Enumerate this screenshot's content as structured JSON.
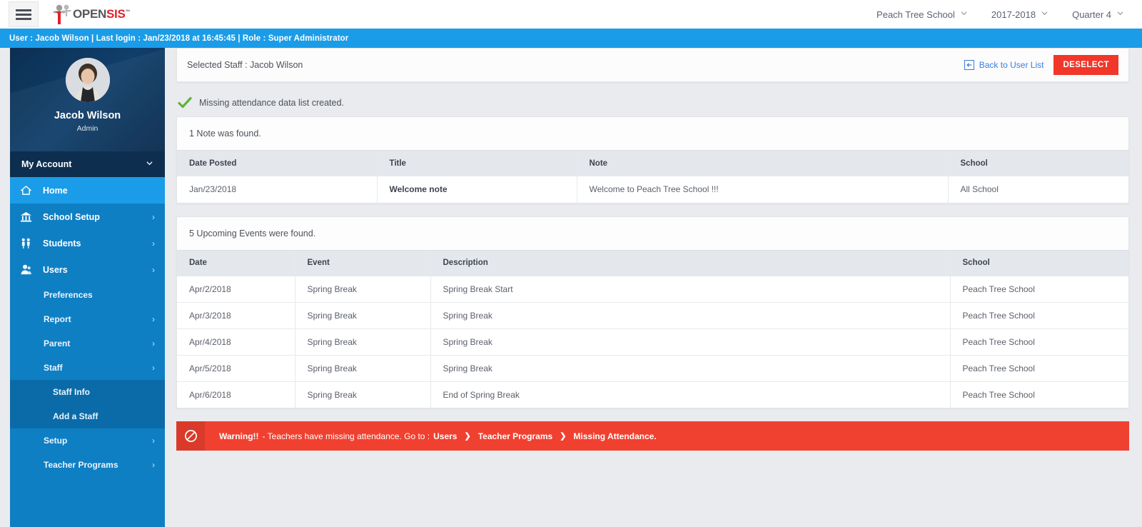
{
  "topbar": {
    "menu_icon": "hamburger-icon",
    "logo": {
      "open": "OPEN",
      "sis": "SIS",
      "tm": "™"
    },
    "selectors": [
      {
        "label": "Peach Tree School",
        "icon": "chevron-down-icon"
      },
      {
        "label": "2017-2018",
        "icon": "chevron-down-icon"
      },
      {
        "label": "Quarter 4",
        "icon": "chevron-down-icon"
      }
    ]
  },
  "userbar": {
    "text": "User : Jacob Wilson | Last login : Jan/23/2018 at 16:45:45 | Role : Super Administrator"
  },
  "sidebar": {
    "profile": {
      "name": "Jacob Wilson",
      "role": "Admin",
      "avatar": "user-avatar"
    },
    "my_account": {
      "label": "My Account",
      "icon": "chevron-down-icon"
    },
    "items": [
      {
        "label": "Home",
        "icon": "home-icon",
        "arrow": "",
        "state": "active"
      },
      {
        "label": "School Setup",
        "icon": "bank-icon",
        "arrow": "›",
        "state": "normal"
      },
      {
        "label": "Students",
        "icon": "students-icon",
        "arrow": "›",
        "state": "normal"
      },
      {
        "label": "Users",
        "icon": "users-icon",
        "arrow": "›",
        "state": "expanded"
      }
    ],
    "users_submenu": [
      {
        "label": "Preferences",
        "arrow": ""
      },
      {
        "label": "Report",
        "arrow": "›"
      },
      {
        "label": "Parent",
        "arrow": "›"
      },
      {
        "label": "Staff",
        "arrow": "›"
      }
    ],
    "staff_submenu": [
      {
        "label": "Staff Info"
      },
      {
        "label": "Add a Staff"
      }
    ],
    "users_submenu_tail": [
      {
        "label": "Setup",
        "arrow": "›"
      },
      {
        "label": "Teacher Programs",
        "arrow": "›"
      }
    ]
  },
  "main": {
    "selected_staff_label": "Selected Staff : Jacob  Wilson",
    "back_link": "Back to User List",
    "back_icon": "arrow-left-boxed-icon",
    "deselect_button": "DESELECT",
    "notice": {
      "icon": "green-check-icon",
      "text": "Missing attendance data list created."
    },
    "notes_panel": {
      "heading": "1 Note was found.",
      "columns": [
        "Date Posted",
        "Title",
        "Note",
        "School"
      ],
      "rows": [
        {
          "date_posted": "Jan/23/2018",
          "title": "Welcome note",
          "note": "Welcome to Peach Tree School !!!",
          "school": "All School"
        }
      ]
    },
    "events_panel": {
      "heading": "5 Upcoming Events were found.",
      "columns": [
        "Date",
        "Event",
        "Description",
        "School"
      ],
      "rows": [
        {
          "date": "Apr/2/2018",
          "event": "Spring Break",
          "description": "Spring Break Start",
          "school": "Peach Tree School"
        },
        {
          "date": "Apr/3/2018",
          "event": "Spring Break",
          "description": "Spring Break",
          "school": "Peach Tree School"
        },
        {
          "date": "Apr/4/2018",
          "event": "Spring Break",
          "description": "Spring Break",
          "school": "Peach Tree School"
        },
        {
          "date": "Apr/5/2018",
          "event": "Spring Break",
          "description": "Spring Break",
          "school": "Peach Tree School"
        },
        {
          "date": "Apr/6/2018",
          "event": "Spring Break",
          "description": "End of Spring Break",
          "school": "Peach Tree School"
        }
      ]
    },
    "warning": {
      "icon": "no-entry-icon",
      "prefix": "Warning!!",
      "text": "- Teachers have missing attendance. Go to :",
      "crumb1": "Users",
      "sep1": "❯",
      "crumb2": "Teacher Programs",
      "sep2": "❯",
      "crumb3": "Missing Attendance."
    }
  },
  "colors": {
    "accent_blue": "#1b9ce8",
    "sidebar_blue": "#0f7fc4",
    "sidebar_dark": "#0d2e4f",
    "danger_red": "#f0372a",
    "link_blue": "#3b7ddd",
    "success_green": "#5cb536"
  }
}
